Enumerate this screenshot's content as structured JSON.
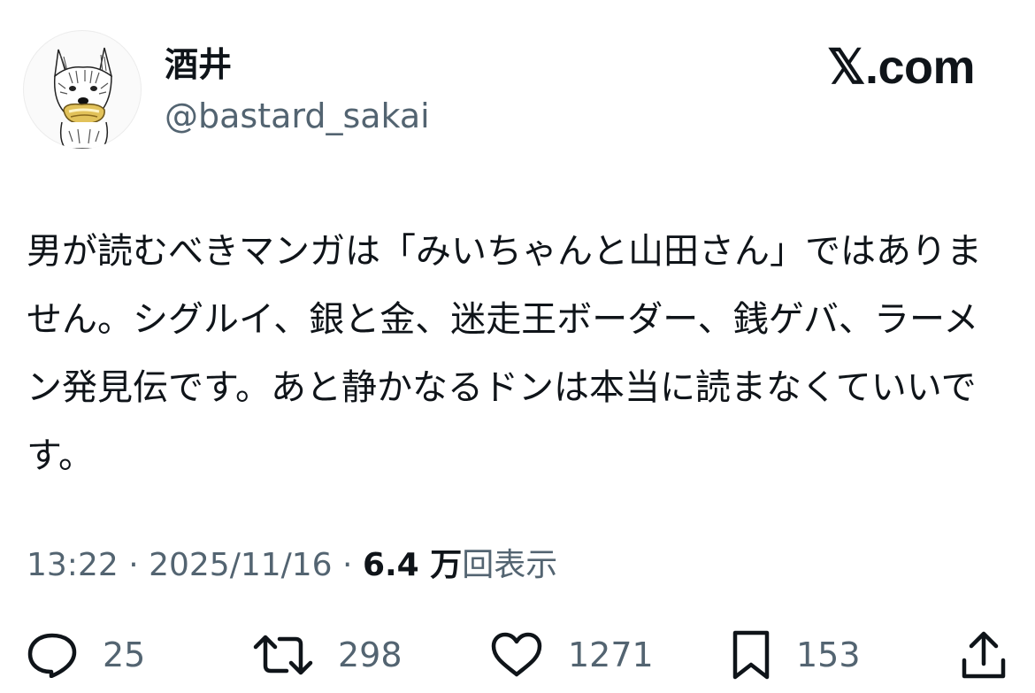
{
  "user": {
    "display_name": "酒井",
    "handle": "@bastard_sakai",
    "avatar_icon": "dog-holding-bread-avatar"
  },
  "brand": {
    "label": "𝕏.com"
  },
  "tweet": {
    "text": "男が読むべきマンガは「みいちゃんと山田さん」ではありません。シグルイ、銀と金、迷走王ボーダー、銭ゲバ、ラーメン発見伝です。あと静かなるドンは本当に読まなくていいです。"
  },
  "meta": {
    "time": "13:22",
    "separator1": " · ",
    "date": "2025/11/16",
    "separator2": " · ",
    "views_count": "6.4 万",
    "views_label": "回表示"
  },
  "actions": {
    "reply": {
      "icon": "reply-icon",
      "count": "25"
    },
    "retweet": {
      "icon": "retweet-icon",
      "count": "298"
    },
    "like": {
      "icon": "heart-icon",
      "count": "1271"
    },
    "bookmark": {
      "icon": "bookmark-icon",
      "count": "153"
    },
    "share": {
      "icon": "share-icon"
    }
  },
  "colors": {
    "text_primary": "#0f1419",
    "text_secondary": "#536471",
    "background": "#ffffff"
  }
}
